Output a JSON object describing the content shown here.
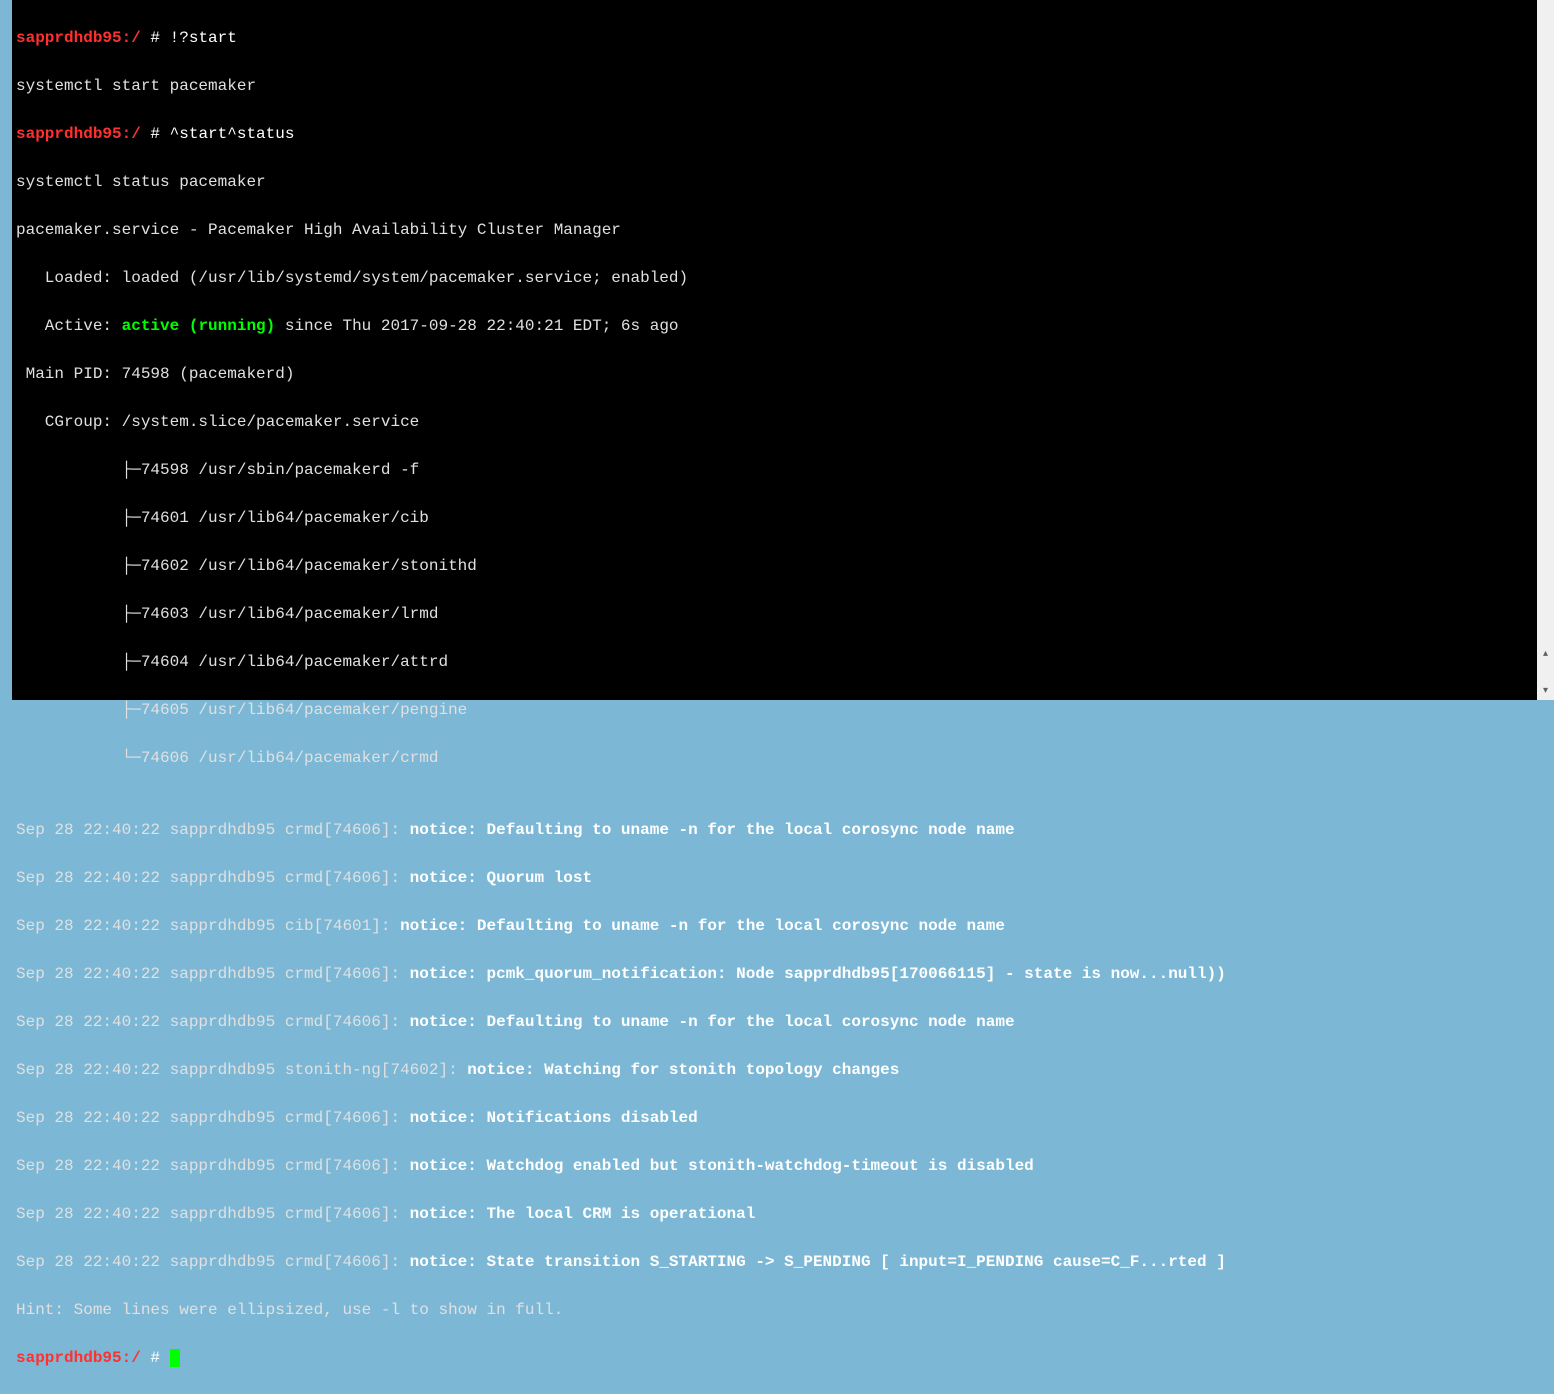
{
  "prompt": {
    "host": "sapprdhdb95:/",
    "hash": " # "
  },
  "lines": {
    "l0_cmd": "!?start",
    "l1": "systemctl start pacemaker",
    "l2_cmd": "^start^status",
    "l3": "systemctl status pacemaker",
    "l4": "pacemaker.service - Pacemaker High Availability Cluster Manager",
    "l5": "   Loaded: loaded (/usr/lib/systemd/system/pacemaker.service; enabled)",
    "l6a": "   Active: ",
    "l6b": "active (running)",
    "l6c": " since Thu 2017-09-28 22:40:21 EDT; 6s ago",
    "l7": " Main PID: 74598 (pacemakerd)",
    "l8": "   CGroup: /system.slice/pacemaker.service",
    "l9": "           ├─74598 /usr/sbin/pacemakerd -f",
    "l10": "           ├─74601 /usr/lib64/pacemaker/cib",
    "l11": "           ├─74602 /usr/lib64/pacemaker/stonithd",
    "l12": "           ├─74603 /usr/lib64/pacemaker/lrmd",
    "l13": "           ├─74604 /usr/lib64/pacemaker/attrd",
    "l14": "           ├─74605 /usr/lib64/pacemaker/pengine",
    "l15": "           └─74606 /usr/lib64/pacemaker/crmd",
    "blank": "",
    "log0a": "Sep 28 22:40:22 sapprdhdb95 crmd[74606]: ",
    "log0b": "notice: Defaulting to uname -n for the local corosync node name",
    "log1a": "Sep 28 22:40:22 sapprdhdb95 crmd[74606]: ",
    "log1b": "notice: Quorum lost",
    "log2a": "Sep 28 22:40:22 sapprdhdb95 cib[74601]: ",
    "log2b": "notice: Defaulting to uname -n for the local corosync node name",
    "log3a": "Sep 28 22:40:22 sapprdhdb95 crmd[74606]: ",
    "log3b": "notice: pcmk_quorum_notification: Node sapprdhdb95[170066115] - state is now...null))",
    "log4a": "Sep 28 22:40:22 sapprdhdb95 crmd[74606]: ",
    "log4b": "notice: Defaulting to uname -n for the local corosync node name",
    "log5a": "Sep 28 22:40:22 sapprdhdb95 stonith-ng[74602]: ",
    "log5b": "notice: Watching for stonith topology changes",
    "log6a": "Sep 28 22:40:22 sapprdhdb95 crmd[74606]: ",
    "log6b": "notice: Notifications disabled",
    "log7a": "Sep 28 22:40:22 sapprdhdb95 crmd[74606]: ",
    "log7b": "notice: Watchdog enabled but stonith-watchdog-timeout is disabled",
    "log8a": "Sep 28 22:40:22 sapprdhdb95 crmd[74606]: ",
    "log8b": "notice: The local CRM is operational",
    "log9a": "Sep 28 22:40:22 sapprdhdb95 crmd[74606]: ",
    "log9b": "notice: State transition S_STARTING -> S_PENDING [ input=I_PENDING cause=C_F...rted ]",
    "hint": "Hint: Some lines were ellipsized, use -l to show in full."
  },
  "scrollbar": {
    "up_glyph": "▴",
    "down_glyph": "▾"
  }
}
